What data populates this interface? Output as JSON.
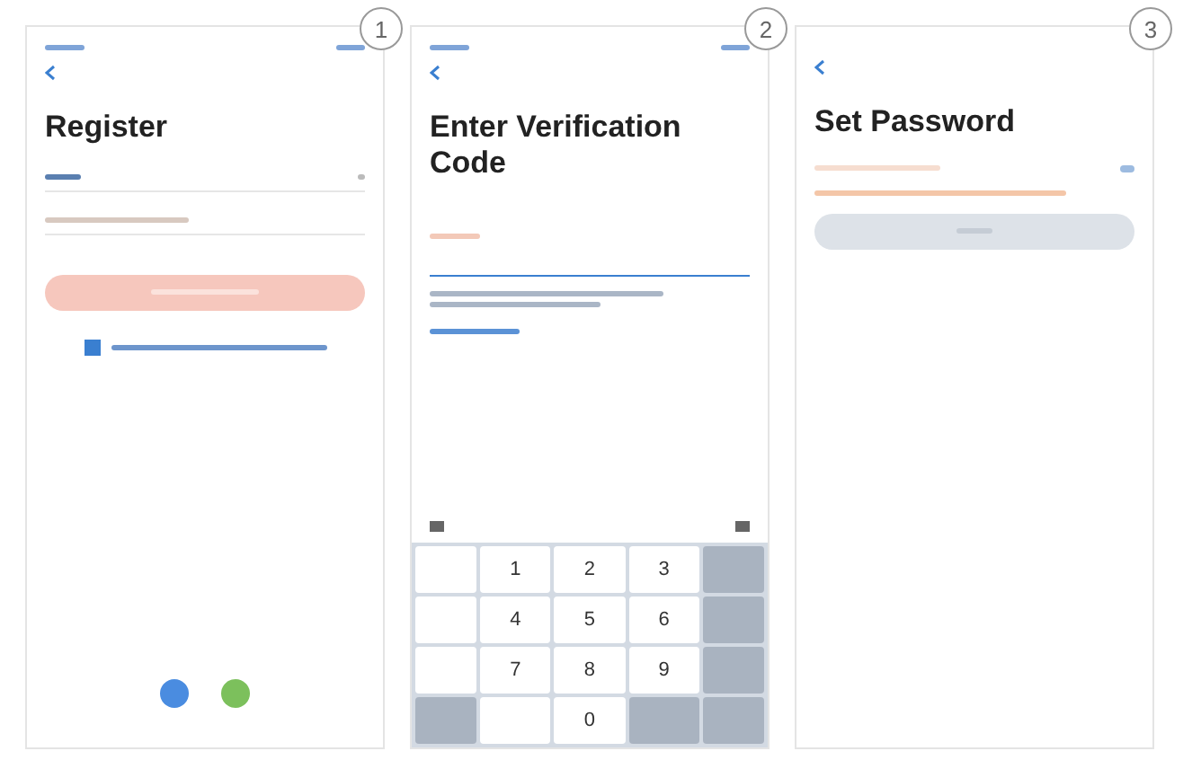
{
  "screens": [
    {
      "kind": "register",
      "step": "1",
      "title": "Register",
      "agreement": {
        "checked": true
      }
    },
    {
      "kind": "verify",
      "step": "2",
      "title": "Enter Verification Code",
      "keypad": {
        "keys": [
          "1",
          "2",
          "3",
          "4",
          "5",
          "6",
          "7",
          "8",
          "9",
          "0"
        ]
      }
    },
    {
      "kind": "password",
      "step": "3",
      "title": "Set Password"
    }
  ]
}
